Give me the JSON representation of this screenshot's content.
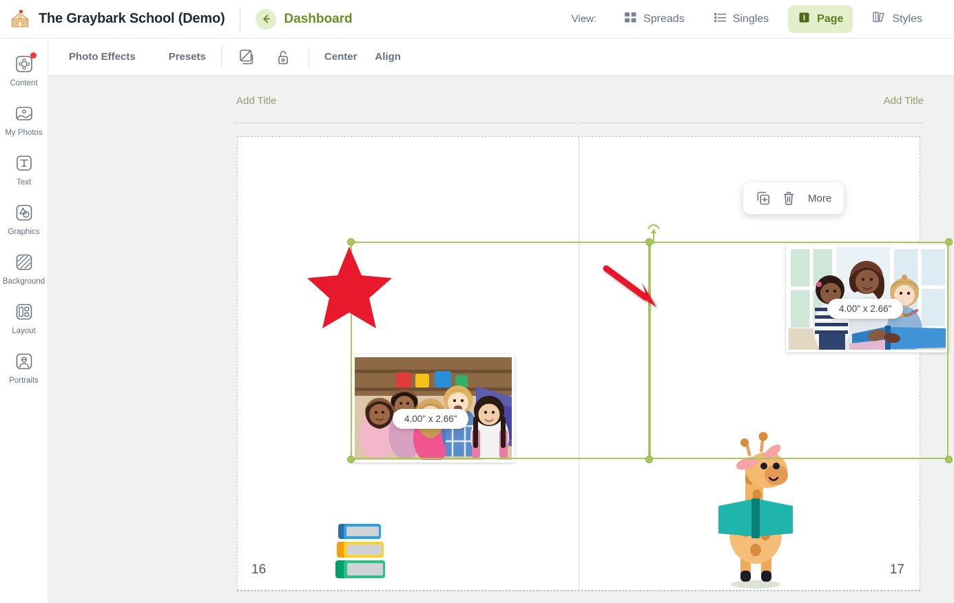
{
  "header": {
    "school_title": "The Graybark School (Demo)",
    "school_icon": "school-building-icon",
    "back_icon": "arrow-left-icon",
    "dashboard_label": "Dashboard",
    "view_label": "View:",
    "view_options": [
      {
        "label": "Spreads",
        "icon": "grid-squares-icon",
        "active": false
      },
      {
        "label": "Singles",
        "icon": "list-icon",
        "active": false
      },
      {
        "label": "Page",
        "icon": "page-icon",
        "active": true
      },
      {
        "label": "Styles",
        "icon": "styles-brush-icon",
        "active": false
      }
    ]
  },
  "toolbar": {
    "photo_effects_label": "Photo Effects",
    "presets_label": "Presets",
    "layers_icon": "layers-icon",
    "lock_icon": "unlock-icon",
    "center_label": "Center",
    "align_label": "Align"
  },
  "sidebar": {
    "items": [
      {
        "label": "Content",
        "icon": "content-nodes-icon",
        "badge": true
      },
      {
        "label": "My Photos",
        "icon": "photo-icon",
        "badge": false
      },
      {
        "label": "Text",
        "icon": "text-t-icon",
        "badge": false
      },
      {
        "label": "Graphics",
        "icon": "graphics-shapes-icon",
        "badge": false
      },
      {
        "label": "Background",
        "icon": "background-pattern-icon",
        "badge": false
      },
      {
        "label": "Layout",
        "icon": "layout-grid-icon",
        "badge": false
      },
      {
        "label": "Portraits",
        "icon": "portrait-person-icon",
        "badge": false
      }
    ]
  },
  "canvas": {
    "title_left": "Add Title",
    "title_right": "Add Title",
    "page_number_left": "16",
    "page_number_right": "17",
    "size_badge_left": "4.00\" x 2.66\"",
    "size_badge_right": "4.00\" x 2.66\"",
    "photo_left_alt": "group-of-children-smiling-photo",
    "photo_right_alt": "woman-reading-book-with-two-children-photo",
    "clipart_books": "stack-of-books-clipart",
    "clipart_giraffe": "giraffe-reading-book-clipart",
    "selection_color": "#a8c95a"
  },
  "context_menu": {
    "duplicate_icon": "duplicate-icon",
    "delete_icon": "trash-icon",
    "more_label": "More"
  },
  "annotations": {
    "arrow": "red-arrow-annotation",
    "star": "red-star-annotation",
    "color": "#e8192c"
  }
}
